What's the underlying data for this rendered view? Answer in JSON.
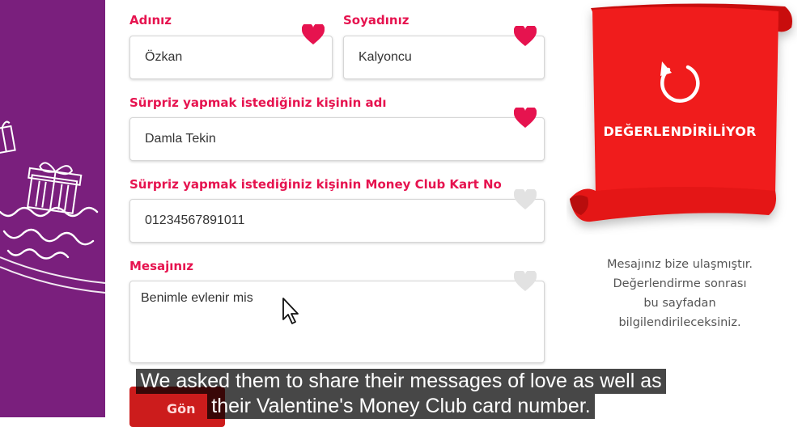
{
  "form": {
    "first_name": {
      "label": "Adınız",
      "value": "Özkan"
    },
    "last_name": {
      "label": "Soyadınız",
      "value": "Kalyoncu"
    },
    "recipient_name": {
      "label": "Sürpriz yapmak istediğiniz kişinin adı",
      "value": "Damla Tekin"
    },
    "recipient_card": {
      "label": "Sürpriz yapmak istediğiniz kişinin Money Club Kart No",
      "value": "01234567891011"
    },
    "message": {
      "label": "Mesajınız",
      "value": "Benimle evlenir mis"
    },
    "submit_label": "Gön"
  },
  "status": {
    "title": "DEĞERLENDİRİLİYOR",
    "info_lines": [
      "Mesajınız bize ulaşmıştır.",
      "Değerlendirme sonrası",
      "bu sayfadan",
      "bilgilendirileceksiniz."
    ]
  },
  "subtitles": [
    "We asked them to share their messages of love as well as",
    "their Valentine's Money Club card number."
  ],
  "colors": {
    "accent": "#e6134f",
    "ribbon": "#f01a1a",
    "sidebar": "#7a1f7d",
    "heart_active": "#e6134f",
    "heart_inactive": "#e2e2e2"
  },
  "icons": {
    "refresh": "refresh-icon",
    "heart": "heart-icon",
    "gift": "gift-icon",
    "cursor": "cursor-arrow-icon"
  }
}
